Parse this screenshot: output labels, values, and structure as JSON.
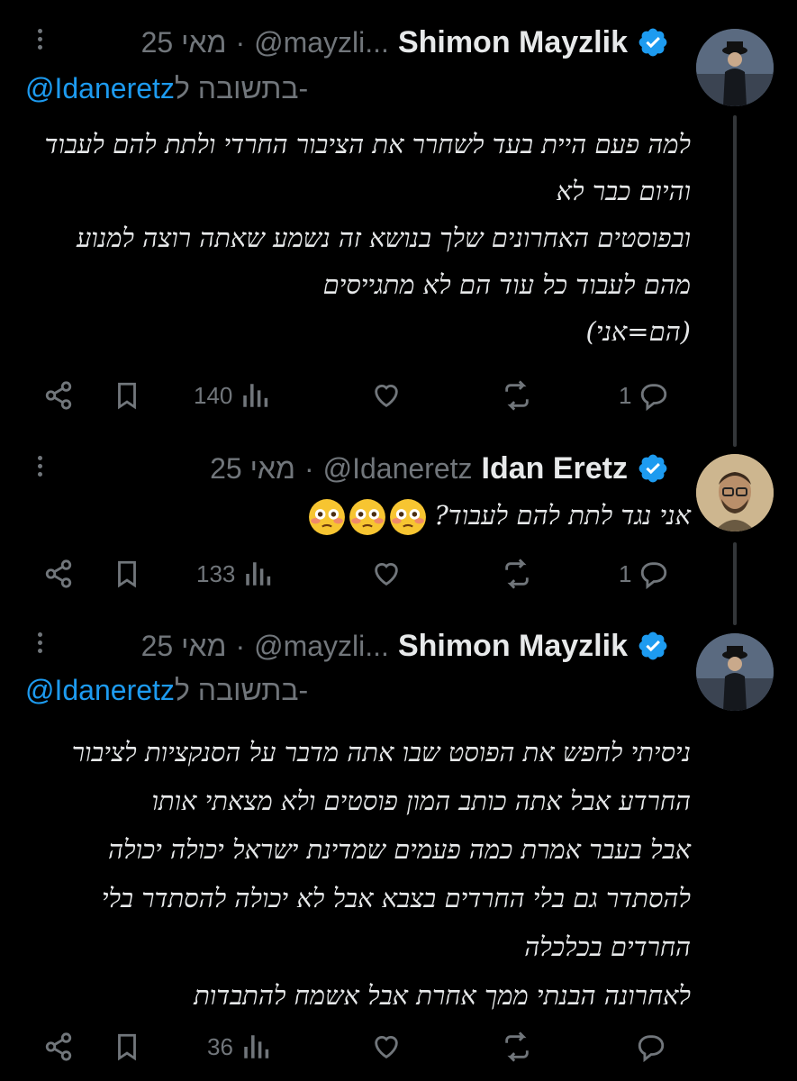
{
  "tweets": [
    {
      "author": {
        "name": "Shimon Mayzlik",
        "handle": "@mayzli...",
        "verified": true
      },
      "time": "25 מאי",
      "reply_to": {
        "prefix": "בתשובה ל-",
        "handle": "@Idaneretz"
      },
      "lines": [
        "למה פעם היית בעד לשחרר את הציבור החרדי ולתת להם לעבוד",
        "והיום כבר לא",
        "ובפוסטים האחרונים שלך בנושא זה נשמע שאתה רוצה למנוע",
        "מהם לעבוד כל עוד הם לא מתגייסים",
        "(הם=אני)"
      ],
      "stats": {
        "views": "140",
        "replies": "1"
      }
    },
    {
      "author": {
        "name": "Idan Eretz",
        "handle": "@Idaneretz",
        "verified": true
      },
      "time": "25 מאי",
      "lines": [
        "אני נגד לתת להם לעבוד?"
      ],
      "emoji": [
        "flushed-face",
        "flushed-face",
        "flushed-face"
      ],
      "stats": {
        "views": "133",
        "replies": "1"
      }
    },
    {
      "author": {
        "name": "Shimon Mayzlik",
        "handle": "@mayzli...",
        "verified": true
      },
      "time": "25 מאי",
      "reply_to": {
        "prefix": "בתשובה ל-",
        "handle": "@Idaneretz"
      },
      "lines": [
        "ניסיתי לחפש את הפוסט שבו אתה מדבר על הסנקציות לציבור",
        "החרדע אבל אתה כותב המון פוסטים ולא מצאתי אותו",
        "אבל בעבר אמרת כמה פעמים שמדינת ישראל יכולה יכולה",
        "להסתדר גם בלי החרדים בצבא אבל לא יכולה להסתדר בלי",
        "החרדים בכלכלה",
        "לאחרונה הבנתי ממך אחרת אבל אשמח להתבדות"
      ],
      "stats": {
        "views": "36",
        "replies": ""
      }
    }
  ],
  "icons": [
    "share-icon",
    "bookmark-icon",
    "views-icon",
    "like-icon",
    "retweet-icon",
    "reply-icon",
    "verified-icon",
    "more-icon"
  ],
  "colors": {
    "background": "#000000",
    "text": "#e7e9ea",
    "muted": "#71767b",
    "link": "#1d9bf0",
    "verified": "#1d9bf0",
    "thread_line": "#333639"
  }
}
